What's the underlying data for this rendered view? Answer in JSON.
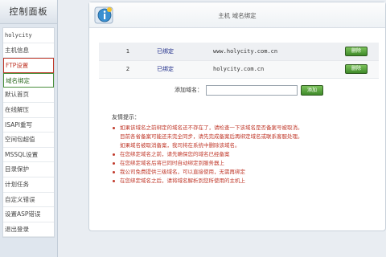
{
  "sidebar": {
    "title": "控制面板",
    "items": [
      {
        "label": "holycity"
      },
      {
        "label": "主机信息"
      },
      {
        "label": "FTP设置"
      },
      {
        "label": "域名绑定"
      },
      {
        "label": "默认首页"
      },
      {
        "label": "在线解压"
      },
      {
        "label": "ISAPI重写"
      },
      {
        "label": "空间包超值"
      },
      {
        "label": "MSSQL设置"
      },
      {
        "label": "目录保护"
      },
      {
        "label": "计划任务"
      },
      {
        "label": "自定义错误"
      },
      {
        "label": "设置ASP错误"
      },
      {
        "label": "退出登录"
      }
    ]
  },
  "header": {
    "title": "主机 域名绑定"
  },
  "domains": [
    {
      "index": "1",
      "status": "已绑定",
      "domain": "www.holycity.com.cn",
      "action": "删除"
    },
    {
      "index": "2",
      "status": "已绑定",
      "domain": "holycity.com.cn",
      "action": "删除"
    }
  ],
  "add_domain": {
    "label": "添加域名：",
    "value": "",
    "button": "添加"
  },
  "tips": {
    "title": "友情提示：",
    "lines": [
      {
        "bullet": true,
        "text": "如果该域名之前绑定的域名还不存在了，请检查一下该域名是否备案号被取消。"
      },
      {
        "bullet": false,
        "text": "目前各省备案可能还未完全同步，请先完成备案后再绑定域名或联系客服处理。"
      },
      {
        "bullet": false,
        "text": "如果域名被取消备案，我司将在系统中删除该域名。"
      },
      {
        "bullet": true,
        "text": "在您绑定域名之前，请先确保您的域名已经备案"
      },
      {
        "bullet": true,
        "text": "在您绑定域名后将已同时自动绑定到服务器上"
      },
      {
        "bullet": true,
        "text": "我公司免费提供三级域名，可以直接使用，无需再绑定"
      },
      {
        "bullet": true,
        "text": "在您绑定域名之后，请将域名解析到您所使用的主机上"
      }
    ]
  },
  "colors": {
    "button_green": "#3f8a2a",
    "status_blue": "#1f2d8a",
    "tip_red": "#c0392b"
  }
}
